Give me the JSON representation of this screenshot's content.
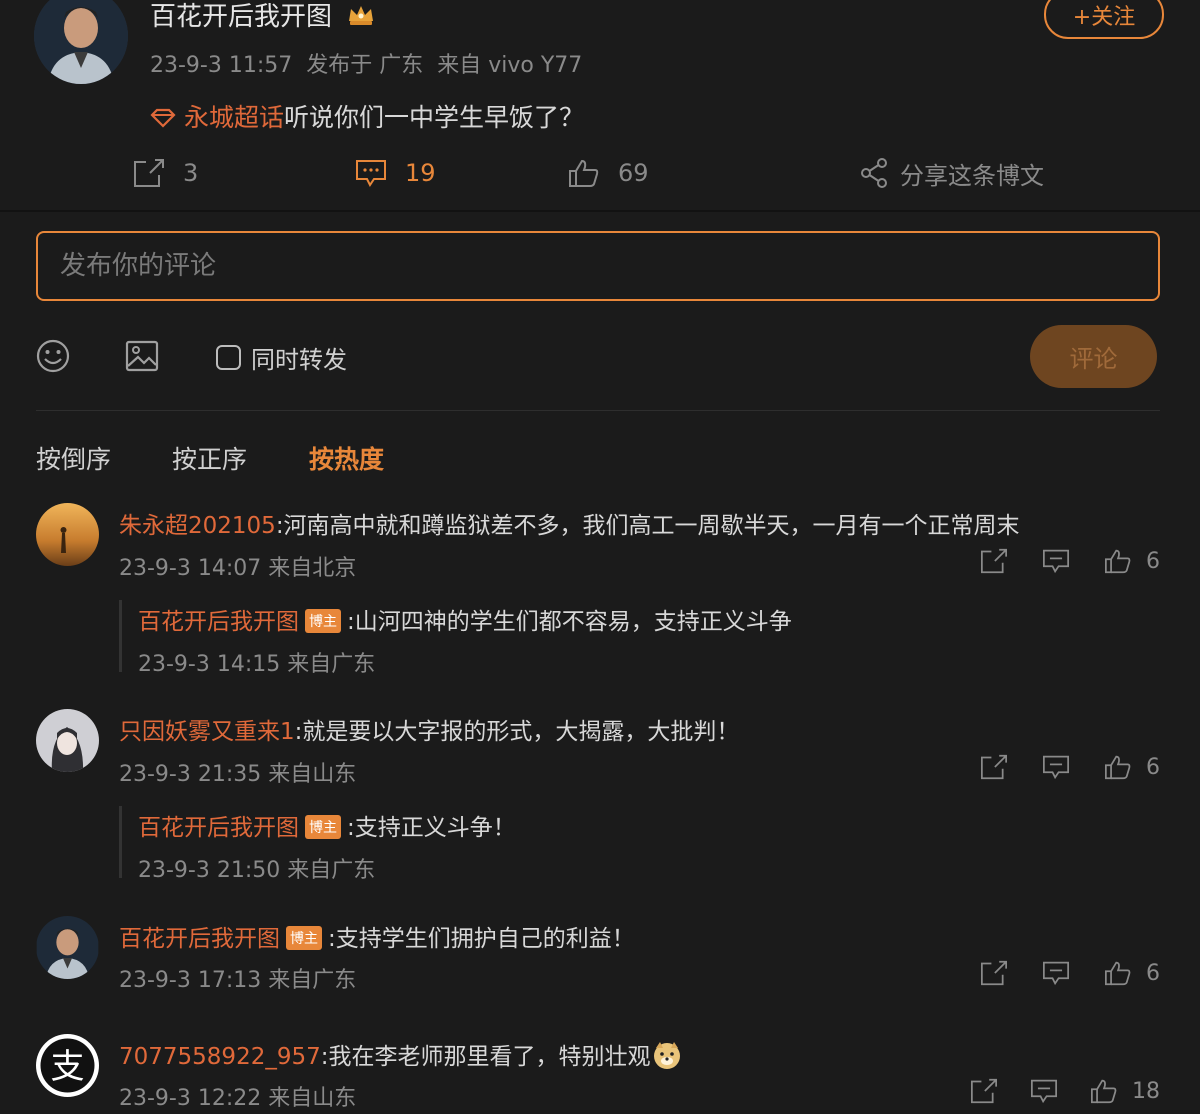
{
  "post": {
    "author": "百花开后我开图",
    "meta": "23-9-3 11:57  发布于 广东  来自 vivo Y77",
    "follow_label": "+关注",
    "topic": "永城超话",
    "text": "听说你们一中学生早饭了？",
    "repost_count": "3",
    "comment_count": "19",
    "like_count": "69",
    "share_label": "分享这条博文"
  },
  "composer": {
    "placeholder": "发布你的评论",
    "repost_label": "同时转发",
    "submit_label": "评论"
  },
  "sort": {
    "reverse": "按倒序",
    "forward": "按正序",
    "hot": "按热度"
  },
  "comments": [
    {
      "author": "朱永超202105",
      "text": ":河南高中就和蹲监狱差不多，我们高工一周歇半天，一月有一个正常周末",
      "meta": "23-9-3 14:07 来自北京",
      "likes": "6",
      "reply": {
        "author": "百花开后我开图",
        "badge": "博主",
        "text": ":山河四神的学生们都不容易，支持正义斗争",
        "meta": "23-9-3 14:15 来自广东"
      }
    },
    {
      "author": "只因妖雾又重来1",
      "text": ":就是要以大字报的形式，大揭露，大批判！",
      "meta": "23-9-3 21:35 来自山东",
      "likes": "6",
      "reply": {
        "author": "百花开后我开图",
        "badge": "博主",
        "text": ":支持正义斗争！",
        "meta": "23-9-3 21:50 来自广东"
      }
    },
    {
      "author": "百花开后我开图",
      "badge": "博主",
      "text": ":支持学生们拥护自己的利益！",
      "meta": "23-9-3 17:13 来自广东",
      "likes": "6"
    },
    {
      "author": "7077558922_957",
      "text": ":我在李老师那里看了，特别壮观",
      "meta": "23-9-3 12:22 来自山东",
      "likes": "18"
    }
  ],
  "colors": {
    "accent": "#e8873a",
    "background": "#1b1b1b",
    "name": "#e0693a"
  }
}
